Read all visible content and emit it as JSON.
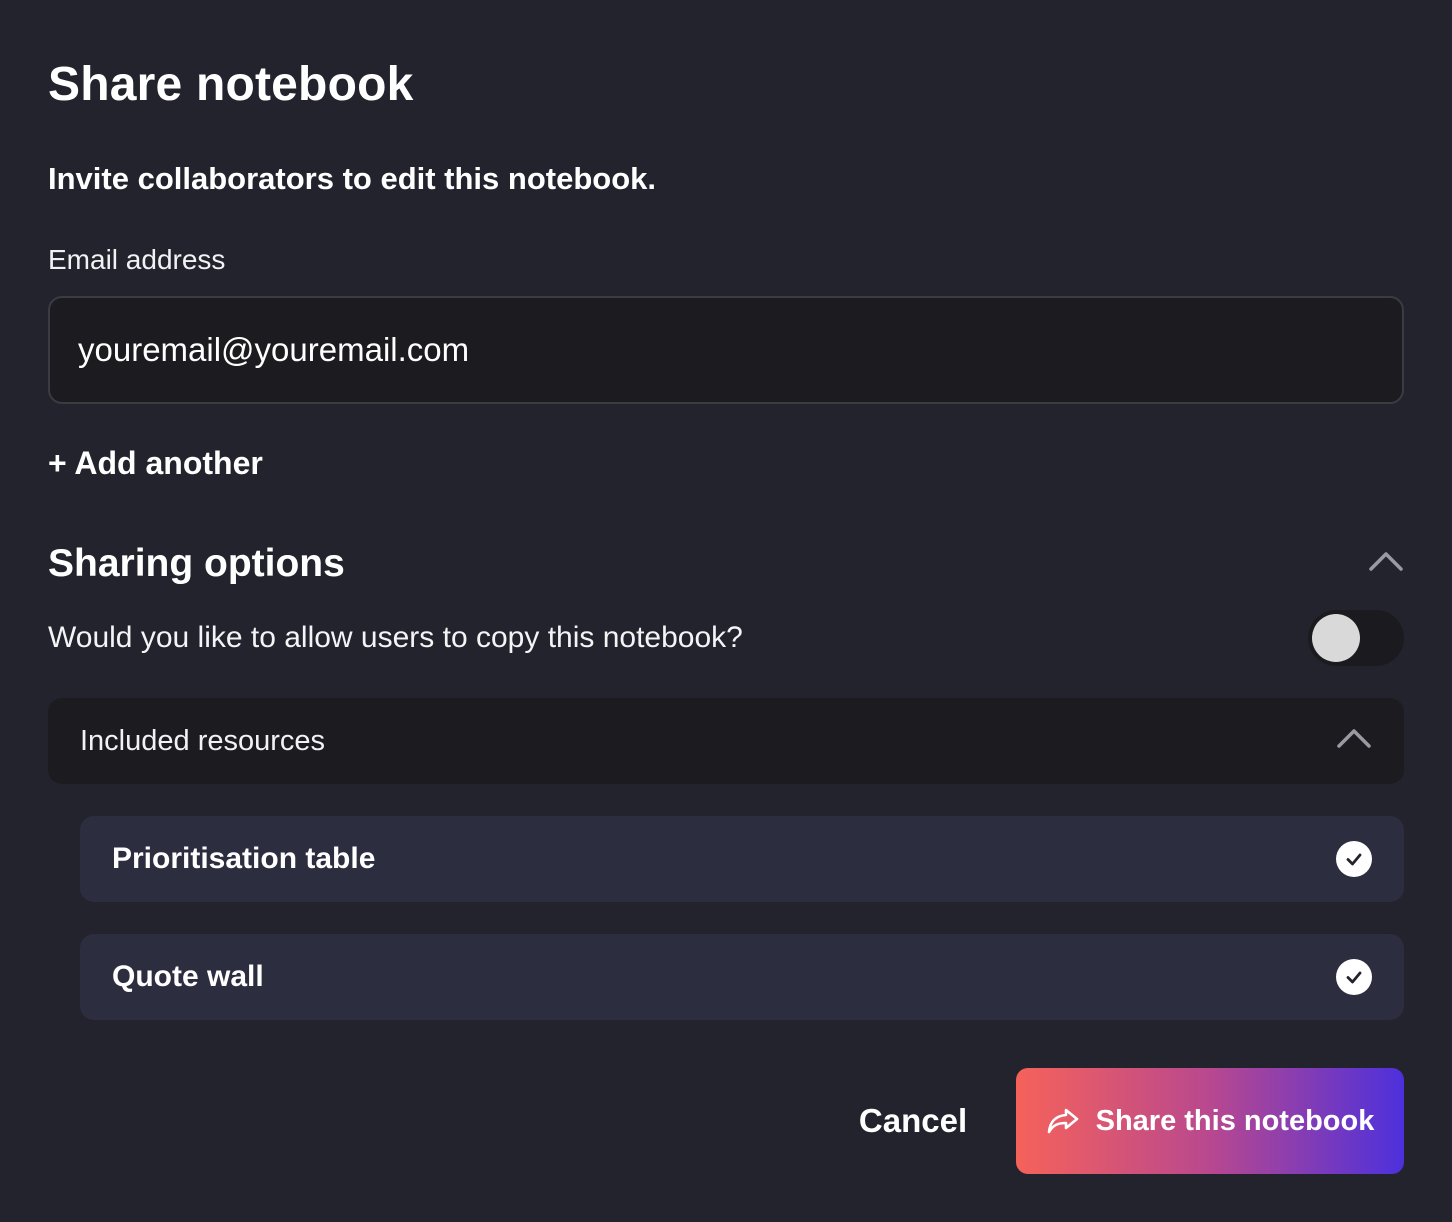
{
  "dialog": {
    "title": "Share notebook",
    "subtitle": "Invite collaborators to edit this notebook."
  },
  "email": {
    "label": "Email address",
    "value": "youremail@youremail.com",
    "placeholder": "youremail@youremail.com"
  },
  "add_another": {
    "label": "+ Add another"
  },
  "sharing_options": {
    "title": "Sharing options",
    "collapse_icon": "chevron-up-icon",
    "copy_question": "Would you like to allow users to copy this notebook?",
    "copy_toggle_on": false
  },
  "included_resources": {
    "label": "Included resources",
    "collapse_icon": "chevron-up-icon",
    "items": [
      {
        "label": "Prioritisation table",
        "checked": true,
        "icon": "check-circle-icon"
      },
      {
        "label": "Quote wall",
        "checked": true,
        "icon": "check-circle-icon"
      }
    ]
  },
  "actions": {
    "cancel_label": "Cancel",
    "share_label": "Share this notebook",
    "share_icon": "share-arrow-icon"
  },
  "colors": {
    "background": "#23232d",
    "input_background": "#1b1b20",
    "resource_item_background": "#2d2d40",
    "share_gradient_start": "#f6625a",
    "share_gradient_end": "#4d30dc",
    "toggle_knob": "#d9d9d9"
  }
}
